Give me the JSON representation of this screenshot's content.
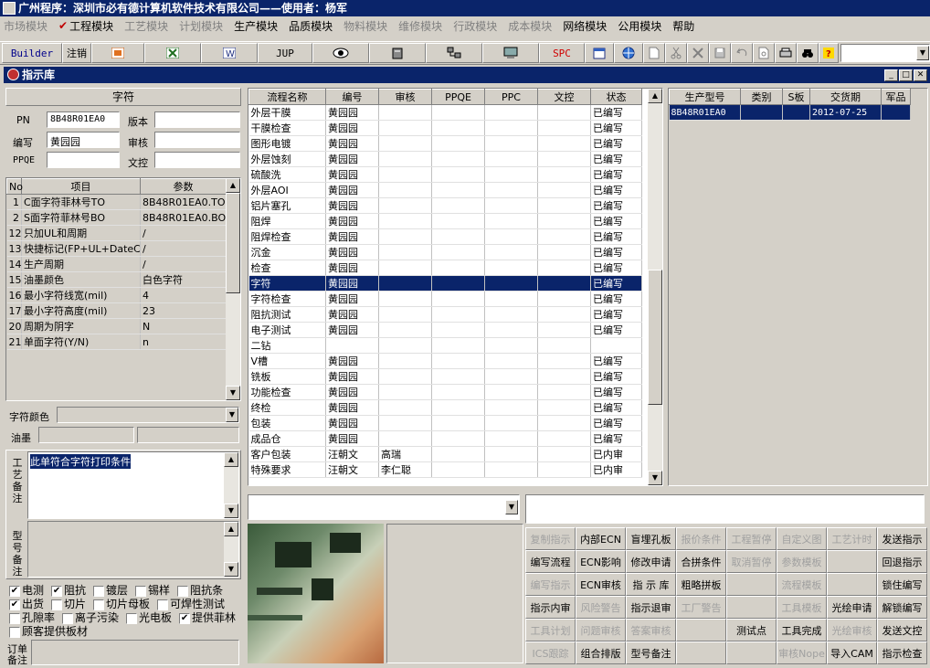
{
  "title": "广州程序：深圳市必有德计算机软件技术有限公司——使用者：杨军",
  "menu": [
    {
      "label": "市场模块",
      "disabled": true
    },
    {
      "label": "工程模块",
      "disabled": false,
      "checked": true
    },
    {
      "label": "工艺模块",
      "disabled": true
    },
    {
      "label": "计划模块",
      "disabled": true
    },
    {
      "label": "生产模块",
      "disabled": false
    },
    {
      "label": "品质模块",
      "disabled": false
    },
    {
      "label": "物料模块",
      "disabled": true
    },
    {
      "label": "维修模块",
      "disabled": true
    },
    {
      "label": "行政模块",
      "disabled": true
    },
    {
      "label": "成本模块",
      "disabled": true
    },
    {
      "label": "网络模块",
      "disabled": false
    },
    {
      "label": "公用模块",
      "disabled": false
    },
    {
      "label": "帮助",
      "disabled": false
    }
  ],
  "toolbar": {
    "builder": "Builder",
    "logout": "注销",
    "jup": "JUP",
    "spc": "SPC"
  },
  "child_window": {
    "title": "指示库"
  },
  "left": {
    "header": "字符",
    "pn_label": "PN",
    "pn_value": "8B48R01EA0",
    "version_label": "版本",
    "version_value": "",
    "editor_label": "编写",
    "editor_value": "黄园园",
    "review_label": "审核",
    "review_value": "",
    "ppqe_label": "PPQE",
    "ppqe_value": "",
    "wenkong_label": "文控",
    "wenkong_value": "",
    "params_headers": [
      "No",
      "项目",
      "参数"
    ],
    "params": [
      {
        "no": "1",
        "item": "C面字符菲林号TO",
        "value": "8B48R01EA0.TO"
      },
      {
        "no": "2",
        "item": "S面字符菲林号BO",
        "value": "8B48R01EA0.BO"
      },
      {
        "no": "12",
        "item": "只加UL和周期",
        "value": "/"
      },
      {
        "no": "13",
        "item": "快捷标记(FP+UL+DateCo",
        "value": "/"
      },
      {
        "no": "14",
        "item": "生产周期",
        "value": "/"
      },
      {
        "no": "15",
        "item": "油墨颜色",
        "value": "白色字符"
      },
      {
        "no": "16",
        "item": "最小字符线宽(mil)",
        "value": "4"
      },
      {
        "no": "17",
        "item": "最小字符高度(mil)",
        "value": "23"
      },
      {
        "no": "20",
        "item": "周期为阴字",
        "value": "N"
      },
      {
        "no": "21",
        "item": "单面字符(Y/N)",
        "value": "n"
      }
    ],
    "char_color_label": "字符颜色",
    "ink_label": "油墨",
    "craft_note_label": "工艺备注",
    "craft_note": "此单符合字符打印条件",
    "model_note_label": "型号备注",
    "order_note_label": "订单备注"
  },
  "checkboxes": [
    [
      {
        "label": "电测",
        "checked": true
      },
      {
        "label": "阻抗",
        "checked": true
      },
      {
        "label": "镀层",
        "checked": false
      },
      {
        "label": "锡样",
        "checked": false
      },
      {
        "label": "阻抗条",
        "checked": false
      }
    ],
    [
      {
        "label": "出货",
        "checked": true
      },
      {
        "label": "切片",
        "checked": false
      },
      {
        "label": "切片母板",
        "checked": false
      },
      {
        "label": "可焊性测试",
        "checked": false
      }
    ],
    [
      {
        "label": "孔隙率",
        "checked": false
      },
      {
        "label": "离子污染",
        "checked": false
      },
      {
        "label": "光电板",
        "checked": false
      },
      {
        "label": "提供菲林",
        "checked": true
      }
    ],
    [
      {
        "label": "顾客提供板材",
        "checked": false
      }
    ]
  ],
  "flow": {
    "headers": [
      "流程名称",
      "编号",
      "审核",
      "PPQE",
      "PPC",
      "文控",
      "状态"
    ],
    "rows": [
      [
        "外层干膜",
        "黄园园",
        "",
        "",
        "",
        "",
        "已编写"
      ],
      [
        "干膜检查",
        "黄园园",
        "",
        "",
        "",
        "",
        "已编写"
      ],
      [
        "图形电镀",
        "黄园园",
        "",
        "",
        "",
        "",
        "已编写"
      ],
      [
        "外层蚀刻",
        "黄园园",
        "",
        "",
        "",
        "",
        "已编写"
      ],
      [
        "硫酸洗",
        "黄园园",
        "",
        "",
        "",
        "",
        "已编写"
      ],
      [
        "外层AOI",
        "黄园园",
        "",
        "",
        "",
        "",
        "已编写"
      ],
      [
        "铝片塞孔",
        "黄园园",
        "",
        "",
        "",
        "",
        "已编写"
      ],
      [
        "阻焊",
        "黄园园",
        "",
        "",
        "",
        "",
        "已编写"
      ],
      [
        "阻焊检查",
        "黄园园",
        "",
        "",
        "",
        "",
        "已编写"
      ],
      [
        "沉金",
        "黄园园",
        "",
        "",
        "",
        "",
        "已编写"
      ],
      [
        "检查",
        "黄园园",
        "",
        "",
        "",
        "",
        "已编写"
      ],
      [
        "字符",
        "黄园园",
        "",
        "",
        "",
        "",
        "已编写"
      ],
      [
        "字符检查",
        "黄园园",
        "",
        "",
        "",
        "",
        "已编写"
      ],
      [
        "阻抗测试",
        "黄园园",
        "",
        "",
        "",
        "",
        "已编写"
      ],
      [
        "电子测试",
        "黄园园",
        "",
        "",
        "",
        "",
        "已编写"
      ],
      [
        "二钻",
        "",
        "",
        "",
        "",
        "",
        ""
      ],
      [
        "V槽",
        "黄园园",
        "",
        "",
        "",
        "",
        "已编写"
      ],
      [
        "铣板",
        "黄园园",
        "",
        "",
        "",
        "",
        "已编写"
      ],
      [
        "功能检查",
        "黄园园",
        "",
        "",
        "",
        "",
        "已编写"
      ],
      [
        "终检",
        "黄园园",
        "",
        "",
        "",
        "",
        "已编写"
      ],
      [
        "包装",
        "黄园园",
        "",
        "",
        "",
        "",
        "已编写"
      ],
      [
        "成品仓",
        "黄园园",
        "",
        "",
        "",
        "",
        "已编写"
      ],
      [
        "客户包装",
        "汪朝文",
        "高瑞",
        "",
        "",
        "",
        "已内审"
      ],
      [
        "特殊要求",
        "汪朝文",
        "李仁聪",
        "",
        "",
        "",
        "已内审"
      ]
    ],
    "selected_index": 11
  },
  "right": {
    "headers": [
      "生产型号",
      "类别",
      "S板",
      "交货期",
      "军品"
    ],
    "rows": [
      [
        "8B48R01EA0",
        "",
        "",
        "2012-07-25",
        ""
      ]
    ]
  },
  "buttons": [
    {
      "label": "复制指示",
      "enabled": false
    },
    {
      "label": "内部ECN",
      "enabled": true
    },
    {
      "label": "盲埋孔板",
      "enabled": true
    },
    {
      "label": "报价条件",
      "enabled": false
    },
    {
      "label": "工程暂停",
      "enabled": false
    },
    {
      "label": "自定义图",
      "enabled": false
    },
    {
      "label": "工艺计时",
      "enabled": false
    },
    {
      "label": "发送指示",
      "enabled": true
    },
    {
      "label": "编写流程",
      "enabled": true
    },
    {
      "label": "ECN影响",
      "enabled": true
    },
    {
      "label": "修改申请",
      "enabled": true
    },
    {
      "label": "合拼条件",
      "enabled": true
    },
    {
      "label": "取消暂停",
      "enabled": false
    },
    {
      "label": "参数模板",
      "enabled": false
    },
    {
      "label": "",
      "enabled": false
    },
    {
      "label": "回退指示",
      "enabled": true
    },
    {
      "label": "编写指示",
      "enabled": false
    },
    {
      "label": "ECN审核",
      "enabled": true
    },
    {
      "label": "指 示 库",
      "enabled": true
    },
    {
      "label": "粗略拼板",
      "enabled": true
    },
    {
      "label": "",
      "enabled": false
    },
    {
      "label": "流程模板",
      "enabled": false
    },
    {
      "label": "",
      "enabled": false
    },
    {
      "label": "锁住编写",
      "enabled": true
    },
    {
      "label": "指示内审",
      "enabled": true
    },
    {
      "label": "风险警告",
      "enabled": false
    },
    {
      "label": "指示退审",
      "enabled": true
    },
    {
      "label": "工厂警告",
      "enabled": false
    },
    {
      "label": "",
      "enabled": false
    },
    {
      "label": "工具模板",
      "enabled": false
    },
    {
      "label": "光绘申请",
      "enabled": true
    },
    {
      "label": "解锁编写",
      "enabled": true
    },
    {
      "label": "工具计划",
      "enabled": false
    },
    {
      "label": "问题审核",
      "enabled": false
    },
    {
      "label": "答案审核",
      "enabled": false
    },
    {
      "label": "",
      "enabled": false
    },
    {
      "label": "测试点",
      "enabled": true
    },
    {
      "label": "工具完成",
      "enabled": true
    },
    {
      "label": "光绘审核",
      "enabled": false
    },
    {
      "label": "发送文控",
      "enabled": true
    },
    {
      "label": "ICS跟踪",
      "enabled": false
    },
    {
      "label": "组合排版",
      "enabled": true
    },
    {
      "label": "型号备注",
      "enabled": true
    },
    {
      "label": "",
      "enabled": false
    },
    {
      "label": "",
      "enabled": false
    },
    {
      "label": "审核Nope",
      "enabled": false
    },
    {
      "label": "导入CAM",
      "enabled": true
    },
    {
      "label": "指示检查",
      "enabled": true
    }
  ],
  "icons": {
    "app": "app-icon",
    "child": "child-window-icon"
  }
}
